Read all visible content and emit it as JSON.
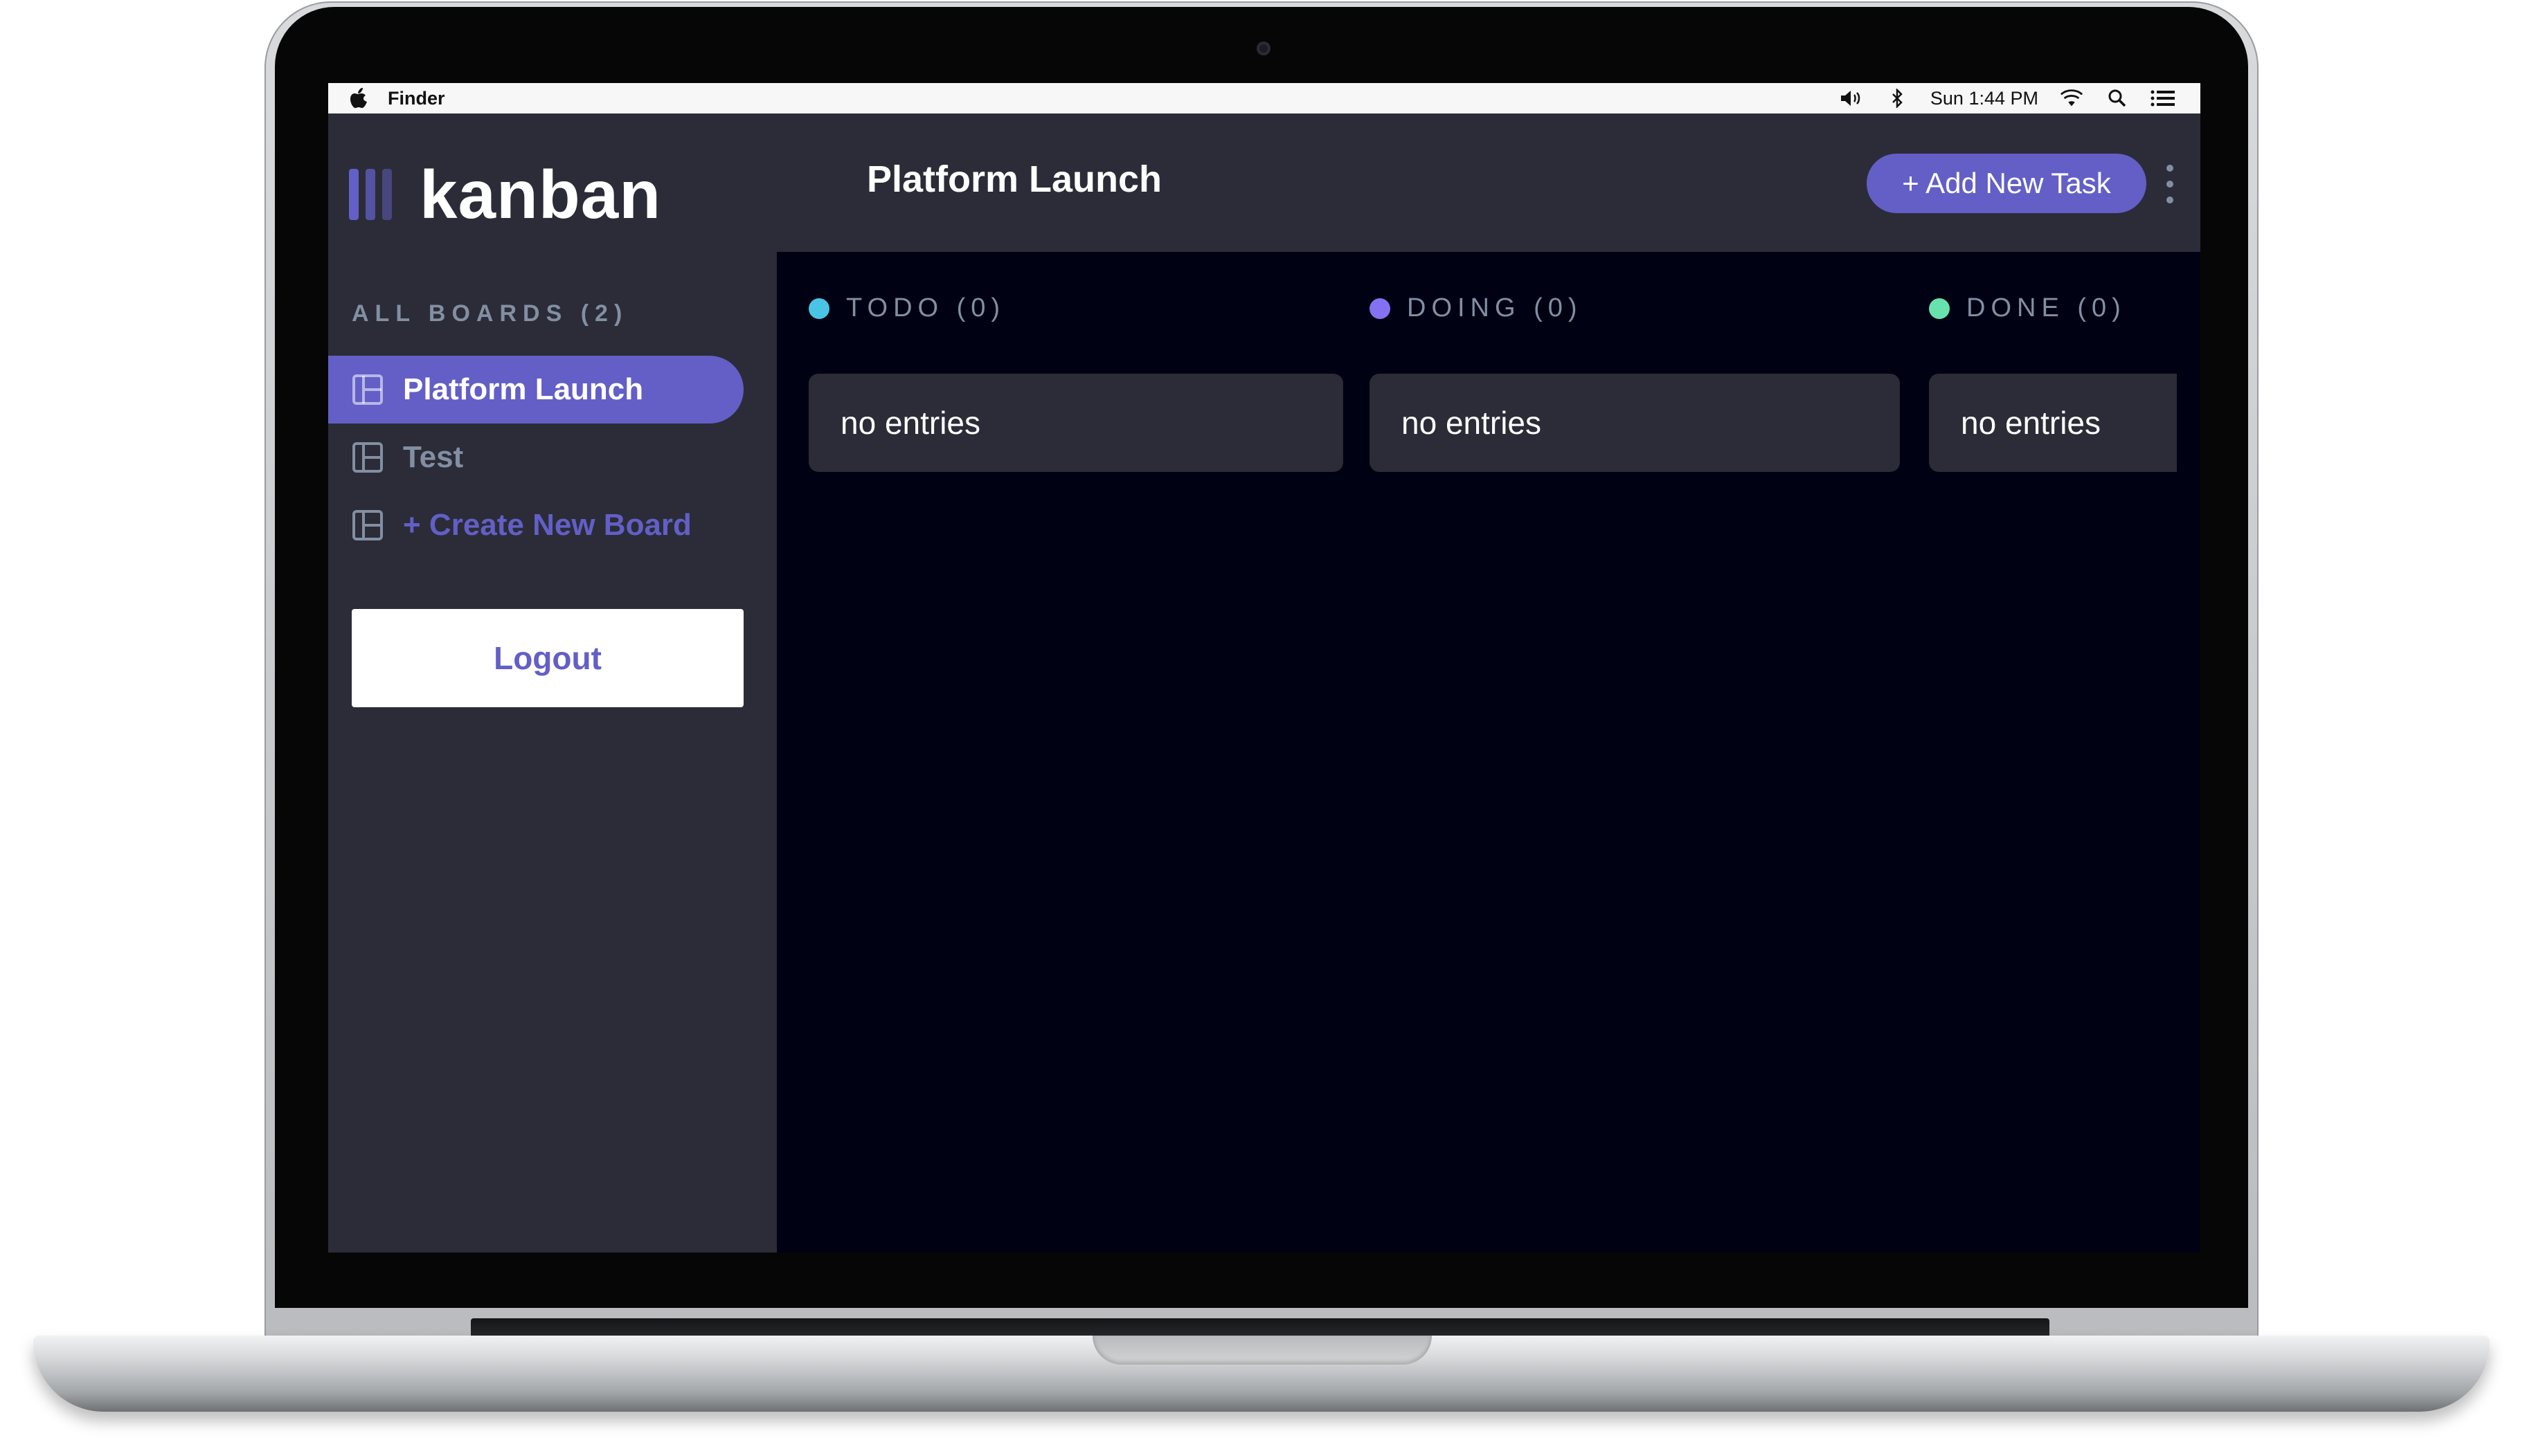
{
  "menubar": {
    "app_name": "Finder",
    "time": "Sun 1:44 PM",
    "icons": [
      "apple-icon",
      "volume-icon",
      "bluetooth-icon",
      "wifi-icon",
      "spotlight-search-icon",
      "notification-list-icon"
    ]
  },
  "app": {
    "logo_text": "kanban",
    "accent_color": "#635fc7",
    "sidebar_bg": "#2b2c37",
    "board_bg": "#000112"
  },
  "sidebar": {
    "section_title": "ALL BOARDS (2)",
    "boards": [
      {
        "label": "Platform Launch",
        "active": true
      },
      {
        "label": "Test",
        "active": false
      }
    ],
    "create_label": "+ Create New Board",
    "logout_label": "Logout"
  },
  "header": {
    "board_title": "Platform Launch",
    "add_task_label": "+ Add New Task"
  },
  "columns": [
    {
      "title": "TODO (0)",
      "color": "#49c4e5",
      "empty_label": "no entries"
    },
    {
      "title": "DOING (0)",
      "color": "#8471f2",
      "empty_label": "no entries"
    },
    {
      "title": "DONE (0)",
      "color": "#67e2ae",
      "empty_label": "no entries"
    }
  ]
}
